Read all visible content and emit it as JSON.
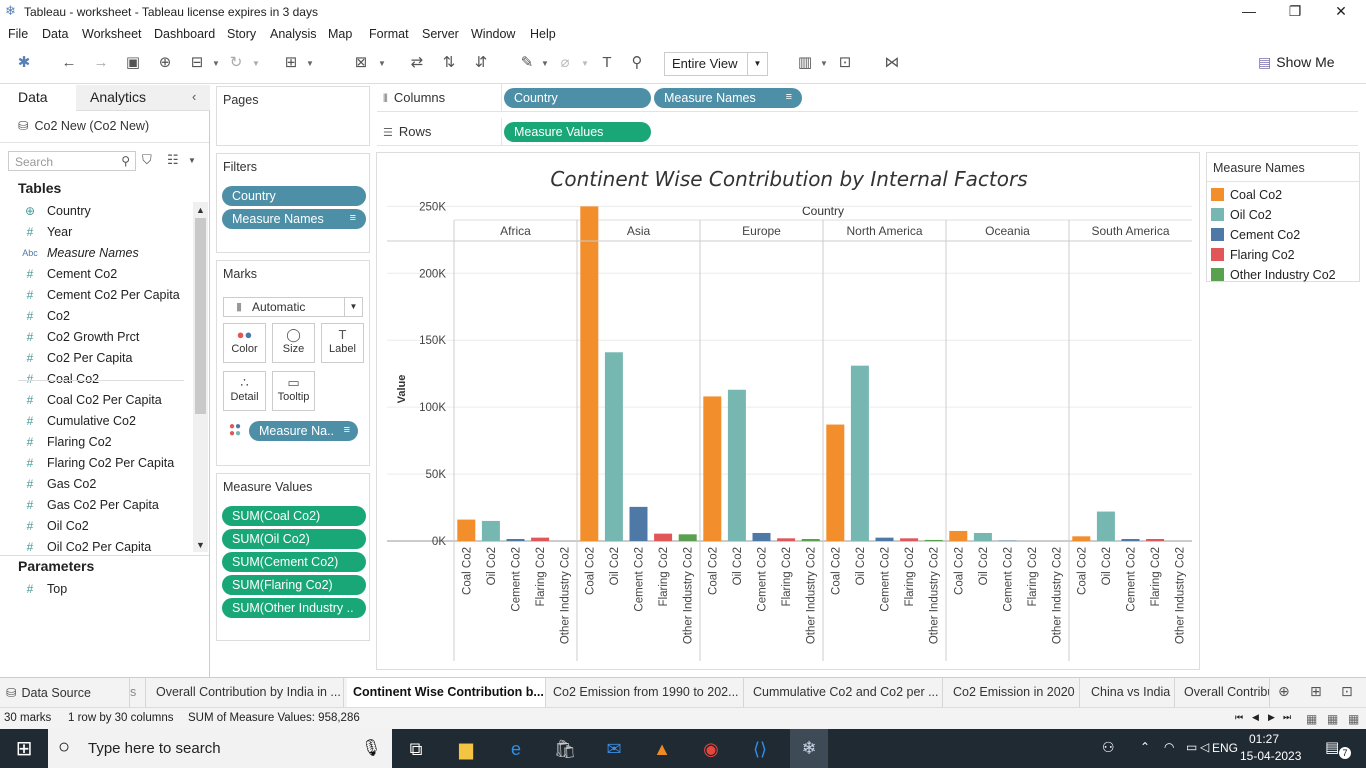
{
  "window": {
    "title": "Tableau - worksheet - Tableau license expires in 3 days",
    "minimize": "—",
    "restore": "❐",
    "close": "✕"
  },
  "menu": [
    "File",
    "Data",
    "Worksheet",
    "Dashboard",
    "Story",
    "Analysis",
    "Map",
    "Format",
    "Server",
    "Window",
    "Help"
  ],
  "toolbar": {
    "fit": "Entire View",
    "show_me": "Show Me"
  },
  "left": {
    "tab_data": "Data",
    "tab_analytics": "Analytics",
    "datasource": "Co2 New (Co2 New)",
    "search_placeholder": "Search",
    "tables_header": "Tables",
    "fields": [
      {
        "icon": "⊕",
        "name": "Country"
      },
      {
        "icon": "#",
        "name": "Year"
      },
      {
        "icon": "Abc",
        "name": "Measure Names"
      },
      {
        "icon": "#",
        "name": "Cement Co2"
      },
      {
        "icon": "#",
        "name": "Cement Co2 Per Capita"
      },
      {
        "icon": "#",
        "name": "Co2"
      },
      {
        "icon": "#",
        "name": "Co2 Growth Prct"
      },
      {
        "icon": "#",
        "name": "Co2 Per Capita"
      },
      {
        "icon": "#",
        "name": "Coal Co2"
      },
      {
        "icon": "#",
        "name": "Coal Co2 Per Capita"
      },
      {
        "icon": "#",
        "name": "Cumulative Co2"
      },
      {
        "icon": "#",
        "name": "Flaring Co2"
      },
      {
        "icon": "#",
        "name": "Flaring Co2 Per Capita"
      },
      {
        "icon": "#",
        "name": "Gas Co2"
      },
      {
        "icon": "#",
        "name": "Gas Co2 Per Capita"
      },
      {
        "icon": "#",
        "name": "Oil Co2"
      },
      {
        "icon": "#",
        "name": "Oil Co2 Per Capita"
      }
    ],
    "parameters_header": "Parameters",
    "parameters": [
      {
        "icon": "#",
        "name": "Top"
      }
    ]
  },
  "cards": {
    "pages": "Pages",
    "filters": "Filters",
    "filter_pills": [
      "Country",
      "Measure Names"
    ],
    "marks": "Marks",
    "mark_type": "Automatic",
    "mark_buttons": [
      {
        "label": "Color",
        "icon": "●"
      },
      {
        "label": "Size",
        "icon": "◯"
      },
      {
        "label": "Label",
        "icon": "T"
      },
      {
        "label": "Detail",
        "icon": "∴"
      },
      {
        "label": "Tooltip",
        "icon": "▭"
      }
    ],
    "color_pill": "Measure Na..",
    "measure_values": "Measure Values",
    "measure_pills": [
      "SUM(Coal Co2)",
      "SUM(Oil Co2)",
      "SUM(Cement Co2)",
      "SUM(Flaring Co2)",
      "SUM(Other Industry .."
    ]
  },
  "shelves": {
    "columns_label": "Columns",
    "rows_label": "Rows",
    "columns": [
      "Country",
      "Measure Names"
    ],
    "rows": [
      "Measure Values"
    ]
  },
  "chart_data": {
    "type": "bar",
    "title": "Continent Wise Contribution by Internal Factors",
    "header": "Country",
    "ylabel": "Value",
    "ylim": [
      0,
      260000
    ],
    "yticks": [
      0,
      50000,
      100000,
      150000,
      200000,
      250000
    ],
    "ytick_labels": [
      "0K",
      "50K",
      "100K",
      "150K",
      "200K",
      "250K"
    ],
    "panels": [
      "Africa",
      "Asia",
      "Europe",
      "North America",
      "Oceania",
      "South America"
    ],
    "measures": [
      "Coal Co2",
      "Oil Co2",
      "Cement Co2",
      "Flaring Co2",
      "Other Industry Co2"
    ],
    "colors": [
      "#f28e2b",
      "#76b7b2",
      "#4e79a7",
      "#e15759",
      "#59a14f"
    ],
    "series": [
      {
        "name": "Coal Co2",
        "values": [
          16000,
          250000,
          108000,
          87000,
          7500,
          3500
        ]
      },
      {
        "name": "Oil Co2",
        "values": [
          15000,
          141000,
          113000,
          131000,
          6000,
          22000
        ]
      },
      {
        "name": "Cement Co2",
        "values": [
          1500,
          25500,
          6000,
          2500,
          400,
          1500
        ]
      },
      {
        "name": "Flaring Co2",
        "values": [
          2500,
          5500,
          2000,
          2000,
          0,
          1500
        ]
      },
      {
        "name": "Other Industry Co2",
        "values": [
          0,
          5000,
          1500,
          800,
          0,
          0
        ]
      }
    ],
    "grid": true,
    "legend_position": "right"
  },
  "legend": {
    "title": "Measure Names"
  },
  "sheet_tabs": [
    "Data Source",
    "s",
    "Overall Contribution by India in ...",
    "Continent  Wise Contribution b...",
    "Co2 Emission from 1990 to 202...",
    "Cummulative Co2 and Co2 per ...",
    "Co2 Emission in 2020",
    "China vs India",
    "Overall Contribu"
  ],
  "status": {
    "marks": "30 marks",
    "rows": "1 row by 30 columns",
    "sum": "SUM of Measure Values: 958,286"
  },
  "taskbar": {
    "search_placeholder": "Type here to search",
    "lang": "ENG",
    "time": "01:27",
    "date": "15-04-2023",
    "notifications": "7"
  }
}
